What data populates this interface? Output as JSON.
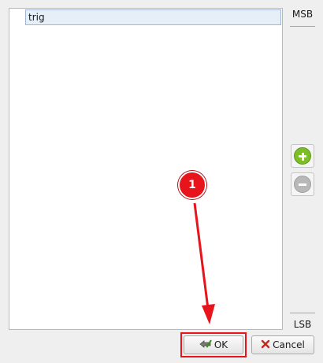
{
  "list": {
    "items": [
      {
        "label": "trig"
      }
    ]
  },
  "side": {
    "msb_label": "MSB",
    "lsb_label": "LSB"
  },
  "buttons": {
    "ok_label": "OK",
    "cancel_label": "Cancel"
  },
  "annotation": {
    "step_number": "1",
    "color": "#e8141b"
  },
  "icons": {
    "add": "plus-circle-icon",
    "remove": "minus-circle-icon",
    "ok": "checkmark-arrow-icon",
    "cancel": "x-icon"
  }
}
